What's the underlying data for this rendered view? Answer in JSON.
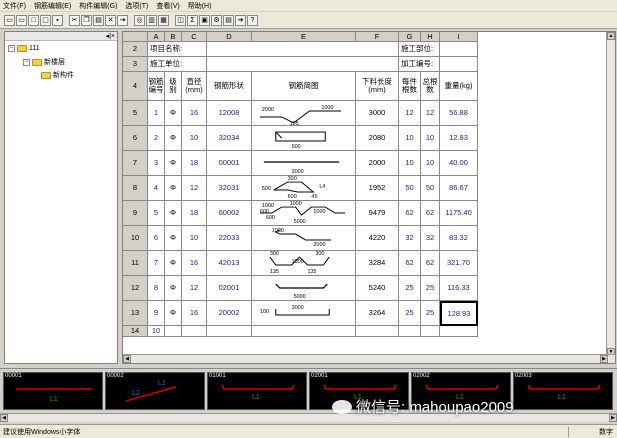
{
  "menu": [
    "文件(F)",
    "钢筋编辑(E)",
    "构件编辑(G)",
    "选项(T)",
    "查看(V)",
    "帮助(H)"
  ],
  "toolbar_icons": [
    "frame-icon",
    "frame2-icon",
    "new-icon",
    "open-icon",
    "save-icon",
    "cut-icon",
    "copy-icon",
    "paste-icon",
    "delete-icon",
    "insert-icon",
    "preview-icon",
    "print-icon",
    "sort-icon",
    "chart-icon",
    "sum-icon",
    "image-icon",
    "config-icon",
    "calc-icon",
    "export-icon",
    "help-icon"
  ],
  "tree": {
    "header": "◂|×",
    "root": "111",
    "child": "新楼层",
    "grandchild": "新构件"
  },
  "columns": [
    "A",
    "B",
    "C",
    "D",
    "E",
    "F",
    "G",
    "H",
    "I"
  ],
  "row_numbers": [
    "2",
    "3",
    "4",
    "5",
    "6",
    "7",
    "8",
    "9",
    "10",
    "11",
    "12",
    "13",
    "14"
  ],
  "info_rows": {
    "project_name": "项目名称:",
    "construction_part": "施工部位:",
    "construction_unit": "施工单位:",
    "processing_no": "加工编号:"
  },
  "headers": [
    "钢筋\n编号",
    "级\n别",
    "直径\n(mm)",
    "钢筋形状",
    "钢筋简图",
    "下料长度\n(mm)",
    "每件\n根数",
    "总根\n数",
    "重量(kg)"
  ],
  "rows": [
    {
      "no": "1",
      "grade": "Φ",
      "dia": "16",
      "shape": "12008",
      "len": "3000",
      "per": "12",
      "total": "12",
      "weight": "56.88",
      "labels": [
        "2000",
        "1000",
        "135"
      ]
    },
    {
      "no": "2",
      "grade": "Φ",
      "dia": "10",
      "shape": "32034",
      "len": "2080",
      "per": "10",
      "total": "10",
      "weight": "12.83",
      "labels": [
        "500"
      ]
    },
    {
      "no": "3",
      "grade": "Φ",
      "dia": "18",
      "shape": "00001",
      "len": "2000",
      "per": "10",
      "total": "10",
      "weight": "40.00",
      "labels": [
        "2000"
      ]
    },
    {
      "no": "4",
      "grade": "Φ",
      "dia": "12",
      "shape": "32031",
      "len": "1952",
      "per": "50",
      "total": "50",
      "weight": "86.67",
      "labels": [
        "300",
        "500",
        "L4",
        "600",
        "45"
      ]
    },
    {
      "no": "5",
      "grade": "Φ",
      "dia": "18",
      "shape": "60002",
      "len": "9479",
      "per": "62",
      "total": "62",
      "weight": "1175.40",
      "labels": [
        "1000",
        "1000",
        "600",
        "1000",
        "600",
        "5000"
      ]
    },
    {
      "no": "6",
      "grade": "Φ",
      "dia": "10",
      "shape": "22033",
      "len": "4220",
      "per": "32",
      "total": "32",
      "weight": "83.32",
      "labels": [
        "1000",
        "2000"
      ]
    },
    {
      "no": "7",
      "grade": "Φ",
      "dia": "16",
      "shape": "42013",
      "len": "3284",
      "per": "62",
      "total": "62",
      "weight": "321.70",
      "labels": [
        "300",
        "300",
        "1000",
        "135",
        "135"
      ]
    },
    {
      "no": "8",
      "grade": "Φ",
      "dia": "12",
      "shape": "02001",
      "len": "5240",
      "per": "25",
      "total": "25",
      "weight": "116.33",
      "labels": [
        "5000"
      ]
    },
    {
      "no": "9",
      "grade": "Φ",
      "dia": "16",
      "shape": "20002",
      "len": "3264",
      "per": "25",
      "total": "25",
      "weight": "128.93",
      "labels": [
        "100",
        "3000"
      ]
    }
  ],
  "row14": {
    "no": "10"
  },
  "thumbnails": [
    {
      "code": "00001",
      "label": "L1"
    },
    {
      "code": "00002",
      "label": "L1",
      "label2": "L2"
    },
    {
      "code": "01001",
      "label": "L1"
    },
    {
      "code": "02001",
      "label": "L1"
    },
    {
      "code": "02002",
      "label": "L1"
    },
    {
      "code": "02003",
      "label": "L1"
    }
  ],
  "watermark": "微信号: mahoupao2009",
  "status": {
    "left": "建议使用Windows小字体",
    "right": "数字"
  },
  "colors": {
    "blue_text": "#1a1aa6",
    "thumb_line_green": "#00c000",
    "thumb_line_red": "#e00000",
    "thumb_line_blue": "#3060ff"
  }
}
